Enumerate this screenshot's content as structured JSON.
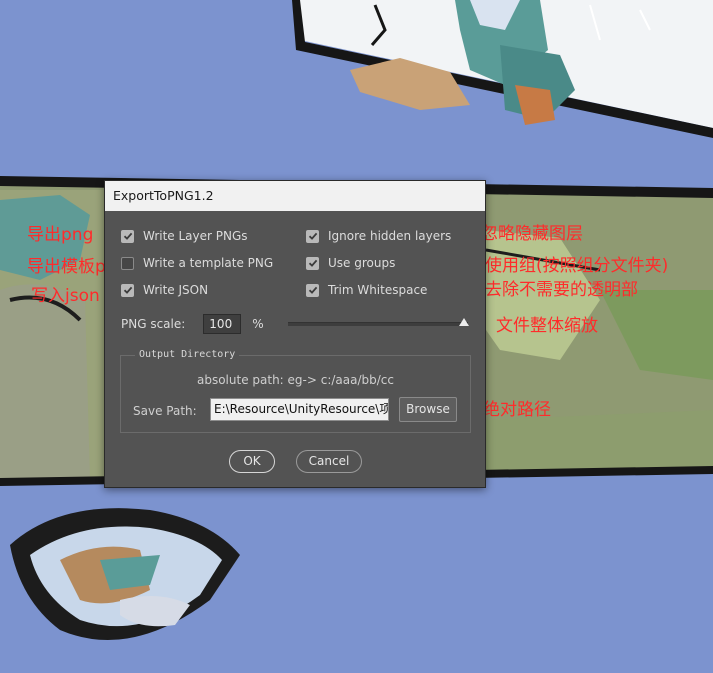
{
  "dialog": {
    "title": "ExportToPNG1.2",
    "options": {
      "write_layer_pngs": {
        "label": "Write Layer PNGs",
        "checked": true
      },
      "write_template_png": {
        "label": "Write a template PNG",
        "checked": false
      },
      "write_json": {
        "label": "Write JSON",
        "checked": true
      },
      "ignore_hidden_layers": {
        "label": "Ignore hidden layers",
        "checked": true
      },
      "use_groups": {
        "label": "Use groups",
        "checked": true
      },
      "trim_whitespace": {
        "label": "Trim Whitespace",
        "checked": true
      }
    },
    "png_scale": {
      "label": "PNG scale:",
      "value": "100",
      "unit": "%"
    },
    "output_directory": {
      "title": "Output Directory",
      "hint": "absolute path: eg-> c:/aaa/bb/cc",
      "save_path_label": "Save Path:",
      "save_path_value": "E:\\Resource\\UnityResource\\项目",
      "browse_label": "Browse"
    },
    "ok_label": "OK",
    "cancel_label": "Cancel"
  },
  "annotations": {
    "export_png": "导出png",
    "export_template_png": "导出模板png",
    "write_json": "写入json",
    "ignore_hidden": "忽略隐藏图层",
    "use_groups": "使用组(按照组分文件夹)",
    "trim": "去除不需要的透明部",
    "scale": "文件整体缩放",
    "absolute_path": "绝对路径"
  },
  "colors": {
    "annotation": "#ff2b2b",
    "dialog_bg": "#535353",
    "background": "#7c93cf"
  }
}
